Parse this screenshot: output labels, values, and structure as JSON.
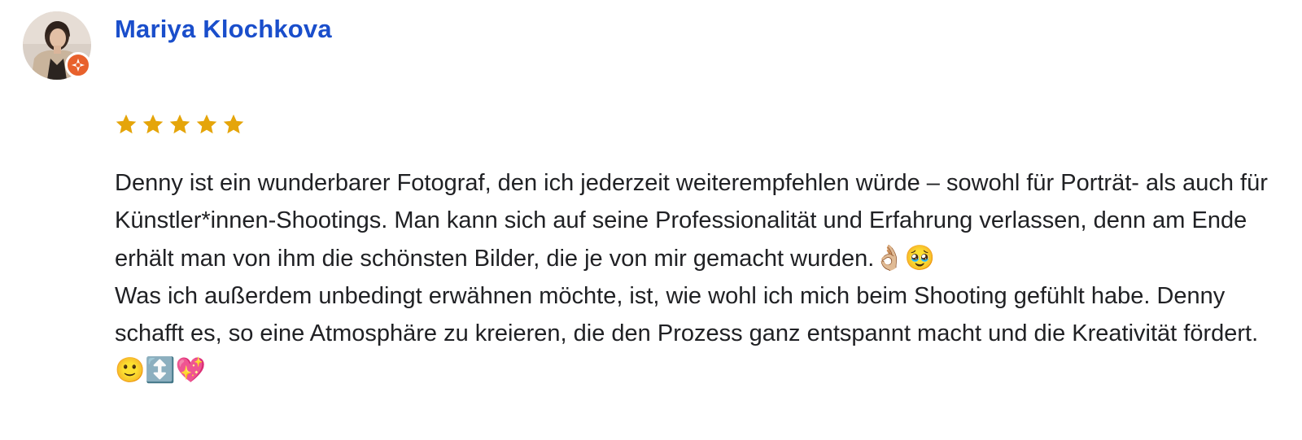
{
  "review": {
    "reviewer_name": "Mariya Klochkova",
    "rating": 5,
    "rating_max": 5,
    "star_color": "#e5a50a",
    "badge_color": "#e8612c",
    "name_color": "#1a4ecb",
    "paragraph_1": "Denny ist ein wunderbarer Fotograf, den ich jederzeit weiterempfehlen würde – sowohl für Porträt- als auch für Künstler*innen-Shootings. Man kann sich auf seine Professionalität und Erfahrung verlassen, denn am Ende erhält man von ihm die schönsten Bilder, die je von mir gemacht wurden.",
    "paragraph_1_emojis": "👌🏼🥹",
    "paragraph_2": "Was ich außerdem unbedingt erwähnen möchte, ist, wie wohl ich mich beim Shooting gefühlt habe. Denny schafft es, so eine Atmosphäre zu kreieren, die den Prozess ganz entspannt macht und die Kreativität fördert.",
    "paragraph_2_emojis": "🙂↕️💖",
    "icons": {
      "avatar": "profile-photo",
      "badge": "local-guide-badge-icon",
      "star": "star-icon"
    }
  }
}
